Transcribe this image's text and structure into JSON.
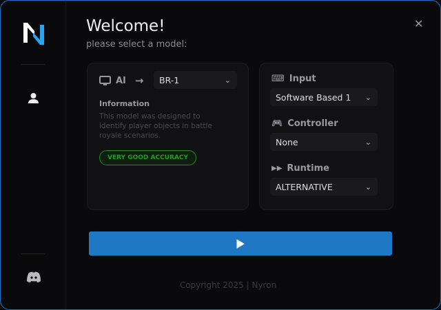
{
  "header": {
    "title": "Welcome!",
    "subtitle": "please select a model:"
  },
  "model": {
    "label": "AI",
    "selected": "BR-1",
    "info_title": "Information",
    "info_text": "This model was designed to identify player objects in battle royale scenarios.",
    "badge": "VERY GOOD ACCURACY"
  },
  "settings": {
    "input": {
      "label": "Input",
      "value": "Software Based 1"
    },
    "controller": {
      "label": "Controller",
      "value": "None"
    },
    "runtime": {
      "label": "Runtime",
      "value": "ALTERNATIVE"
    }
  },
  "footer": {
    "copyright": "Copyright 2025 | Nyron"
  },
  "colors": {
    "accent": "#1e78c4",
    "badge": "#1ea01e"
  }
}
